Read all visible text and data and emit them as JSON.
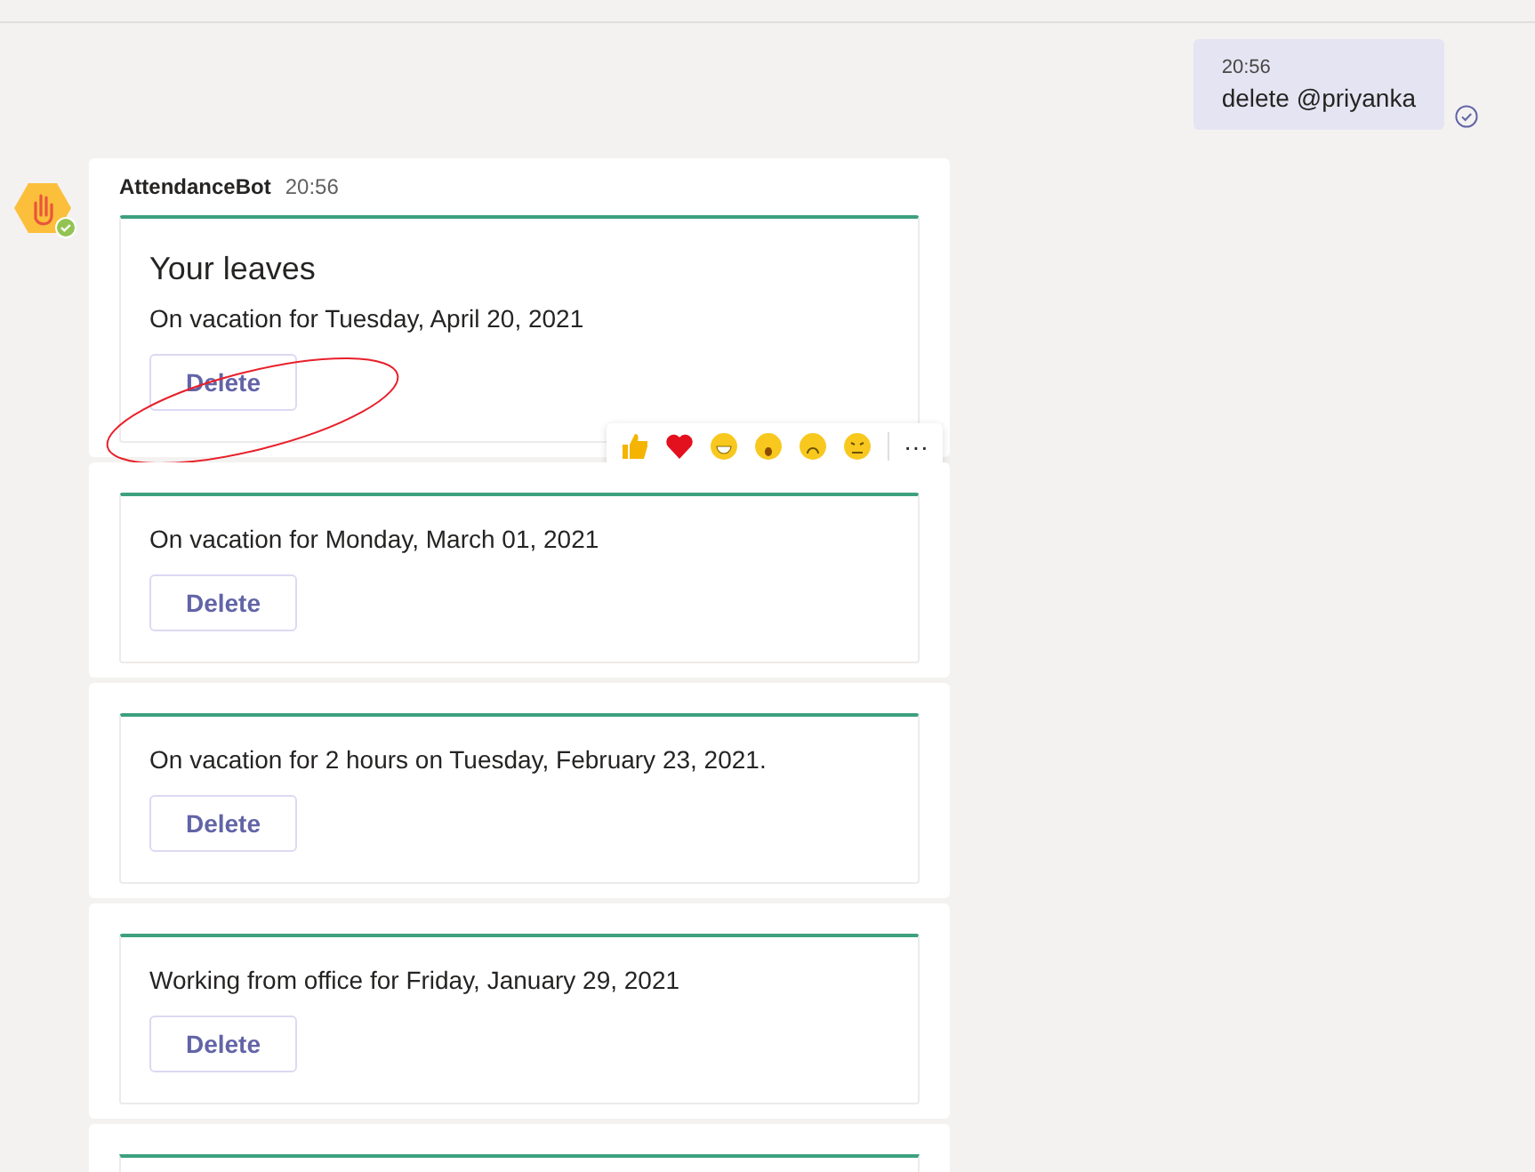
{
  "sent_message": {
    "time": "20:56",
    "text": "delete @priyanka",
    "delivered": true
  },
  "bot": {
    "name": "AttendanceBot",
    "time": "20:56",
    "online": true
  },
  "card_title": "Your leaves",
  "leaves": [
    {
      "text": "On vacation for Tuesday, April 20, 2021",
      "button": "Delete"
    },
    {
      "text": "On vacation for Monday, March 01, 2021",
      "button": "Delete"
    },
    {
      "text": "On vacation for 2 hours on Tuesday, February 23, 2021.",
      "button": "Delete"
    },
    {
      "text": "Working from office for Friday, January 29, 2021",
      "button": "Delete"
    }
  ],
  "more_below": true,
  "reactions": {
    "more": "···"
  }
}
